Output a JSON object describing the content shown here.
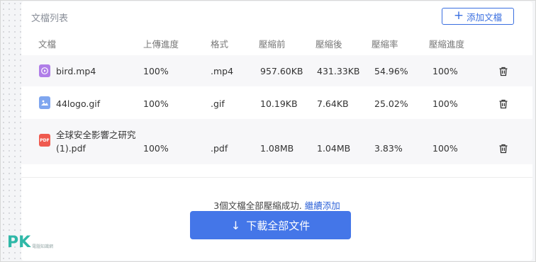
{
  "header": {
    "title": "文檔列表",
    "add_label": "添加文檔"
  },
  "columns": [
    "文檔",
    "上傳進度",
    "格式",
    "壓縮前",
    "壓縮後",
    "壓縮率",
    "壓縮進度"
  ],
  "files": [
    {
      "name": "bird.mp4",
      "name_line2": "",
      "upload": "100%",
      "format": ".mp4",
      "before": "957.60KB",
      "after": "431.33KB",
      "rate": "54.96%",
      "progress": "100%",
      "icon": "video-file-icon"
    },
    {
      "name": "44logo.gif",
      "name_line2": "",
      "upload": "100%",
      "format": ".gif",
      "before": "10.19KB",
      "after": "7.64KB",
      "rate": "25.02%",
      "progress": "100%",
      "icon": "image-file-icon"
    },
    {
      "name": "全球安全影響之研究",
      "name_line2": "(1).pdf",
      "upload": "100%",
      "format": ".pdf",
      "before": "1.08MB",
      "after": "1.04MB",
      "rate": "3.83%",
      "progress": "100%",
      "icon": "pdf-file-icon",
      "icon_text": "PDF"
    }
  ],
  "summary": {
    "text": "3個文檔全部壓縮成功.",
    "link": "繼續添加"
  },
  "download": {
    "label": "下載全部文件"
  },
  "watermark": {
    "brand": "PK",
    "caption": "電腦知識網"
  },
  "colors": {
    "accent": "#4476e8",
    "mp4": "#b07ee8",
    "gif": "#7fa6ef",
    "pdf": "#ef5a4f"
  }
}
